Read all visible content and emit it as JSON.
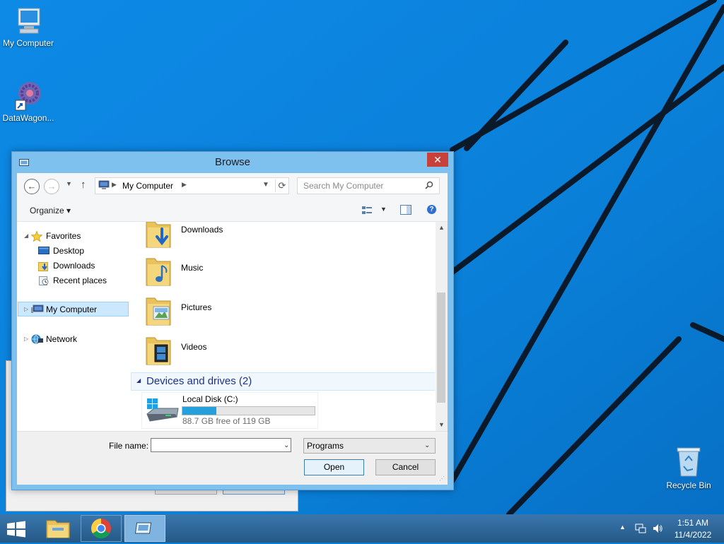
{
  "desktop": {
    "icons": [
      {
        "label": "My Computer"
      },
      {
        "label": "DataWagon..."
      },
      {
        "label": "Recycle Bin"
      }
    ]
  },
  "dialog": {
    "title": "Browse",
    "nav": {
      "address": "My Computer",
      "search_placeholder": "Search My Computer"
    },
    "toolbar": {
      "organize": "Organize"
    },
    "tree": {
      "favorites": "Favorites",
      "desktop": "Desktop",
      "downloads": "Downloads",
      "recent": "Recent places",
      "my_computer": "My Computer",
      "network": "Network"
    },
    "folders": [
      {
        "name": "Downloads"
      },
      {
        "name": "Music"
      },
      {
        "name": "Pictures"
      },
      {
        "name": "Videos"
      }
    ],
    "devices_group": "Devices and drives (2)",
    "drive": {
      "name": "Local Disk (C:)",
      "free_text": "88.7 GB free of 119 GB",
      "used_fraction": 0.255
    },
    "bottom": {
      "file_name_label": "File name:",
      "file_name_value": "",
      "filter_selected": "Programs",
      "open_label": "Open",
      "cancel_label": "Cancel"
    }
  },
  "taskbar": {
    "time": "1:51 AM",
    "date": "11/4/2022"
  },
  "colors": {
    "desktop_bg": "#0a7fd8",
    "dialog_frame": "#7ec0ee",
    "close_red": "#c7403a",
    "selection": "#cce8ff",
    "group_text": "#1e3287",
    "drive_fill": "#26a0da"
  }
}
